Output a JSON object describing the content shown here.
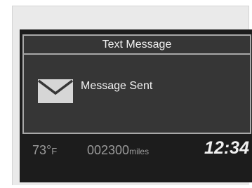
{
  "dialog": {
    "title": "Text Message",
    "status": "Message Sent",
    "icon": "envelope-icon"
  },
  "status_bar": {
    "temperature_value": "73°",
    "temperature_unit": "F",
    "odometer_value": "002300",
    "odometer_unit": "miles",
    "clock": "12:34"
  },
  "colors": {
    "screen_bg": "#1c1c1c",
    "panel_bg": "#363636",
    "panel_border": "#a8a8a8",
    "icon_fill": "#d6d6d6"
  }
}
